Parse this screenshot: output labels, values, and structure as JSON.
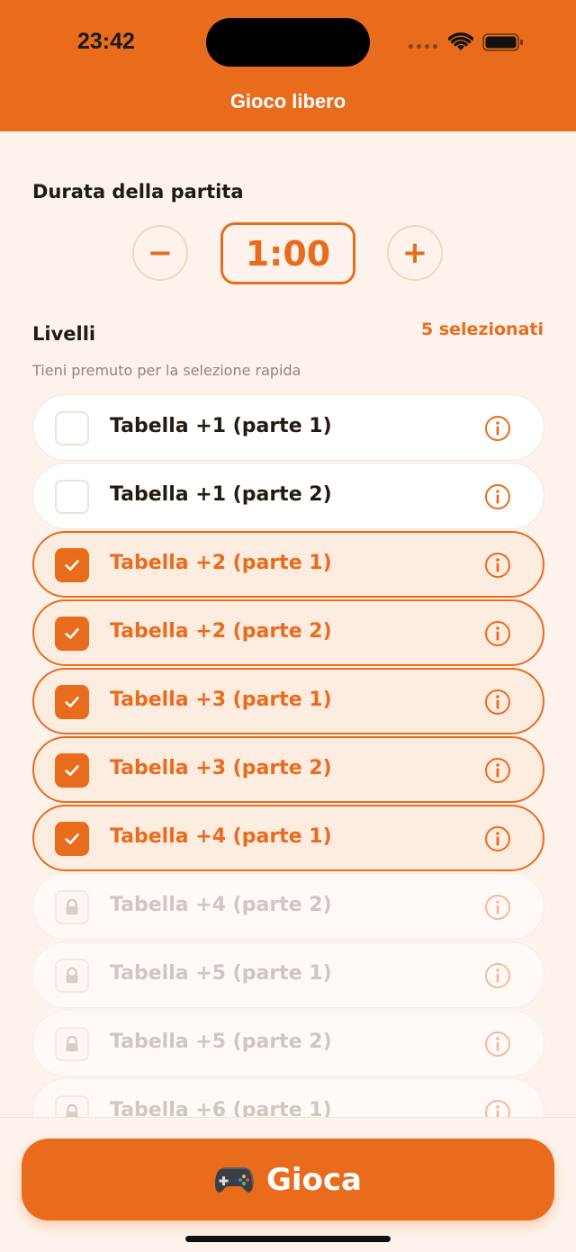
{
  "status_bar": {
    "time": "23:42"
  },
  "header": {
    "title": "Gioco libero"
  },
  "duration": {
    "label": "Durata della partita",
    "value": "1:00",
    "decrement_label": "−",
    "increment_label": "+"
  },
  "levels": {
    "label": "Livelli",
    "selected_count": "5 selezionati",
    "hint": "Tieni premuto per la selezione rapida",
    "items": [
      {
        "label": "Tabella +1 (parte 1)",
        "state": "unselected"
      },
      {
        "label": "Tabella +1 (parte 2)",
        "state": "unselected"
      },
      {
        "label": "Tabella +2 (parte 1)",
        "state": "selected"
      },
      {
        "label": "Tabella +2 (parte 2)",
        "state": "selected"
      },
      {
        "label": "Tabella +3 (parte 1)",
        "state": "selected"
      },
      {
        "label": "Tabella +3 (parte 2)",
        "state": "selected"
      },
      {
        "label": "Tabella +4 (parte 1)",
        "state": "selected"
      },
      {
        "label": "Tabella +4 (parte 2)",
        "state": "locked"
      },
      {
        "label": "Tabella +5 (parte 1)",
        "state": "locked"
      },
      {
        "label": "Tabella +5 (parte 2)",
        "state": "locked"
      },
      {
        "label": "Tabella +6 (parte 1)",
        "state": "locked"
      }
    ]
  },
  "play_button": {
    "label": "Gioca",
    "icon": "gamepad-icon"
  },
  "colors": {
    "accent": "#e96c1d",
    "background": "#fdf3ec"
  }
}
